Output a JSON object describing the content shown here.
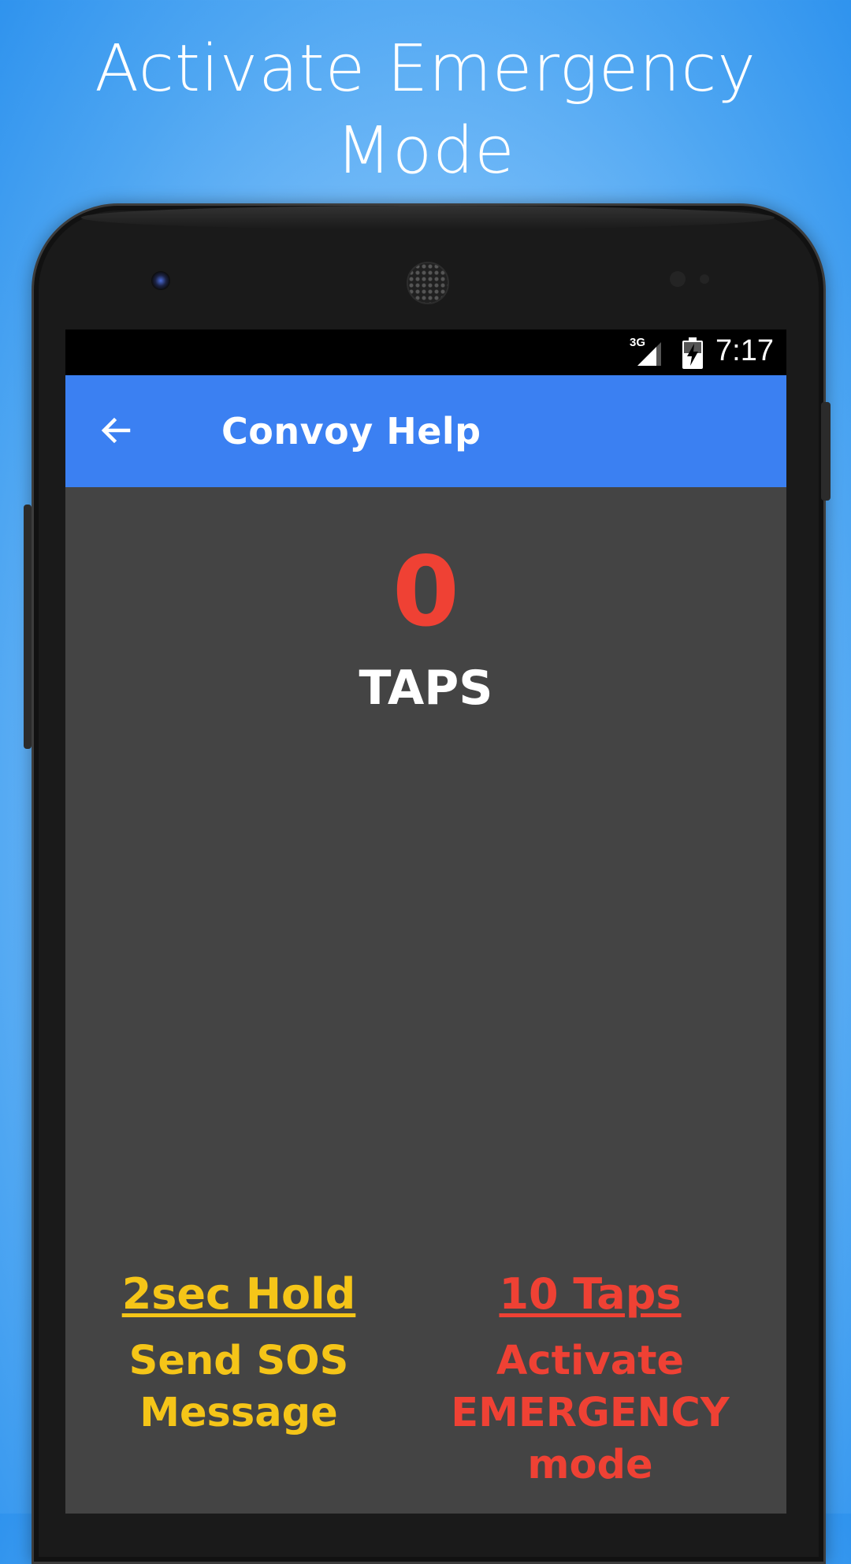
{
  "promo": {
    "headline_line1": "Activate Emergency",
    "headline_line2": "Mode"
  },
  "statusbar": {
    "network": "3G",
    "time": "7:17"
  },
  "appbar": {
    "title": "Convoy Help"
  },
  "counter": {
    "value": "0",
    "label": "TAPS"
  },
  "hints": {
    "hold": {
      "title": "2sec Hold",
      "desc_line1": "Send SOS",
      "desc_line2": "Message"
    },
    "taps": {
      "title": "10 Taps",
      "desc_line1": "Activate",
      "desc_line2": "EMERGENCY",
      "desc_line3": "mode"
    }
  },
  "colors": {
    "appbar": "#3b80f2",
    "screen_bg": "#444444",
    "counter": "#ef4134",
    "hold_hint": "#f5c518",
    "taps_hint": "#ef4134"
  }
}
